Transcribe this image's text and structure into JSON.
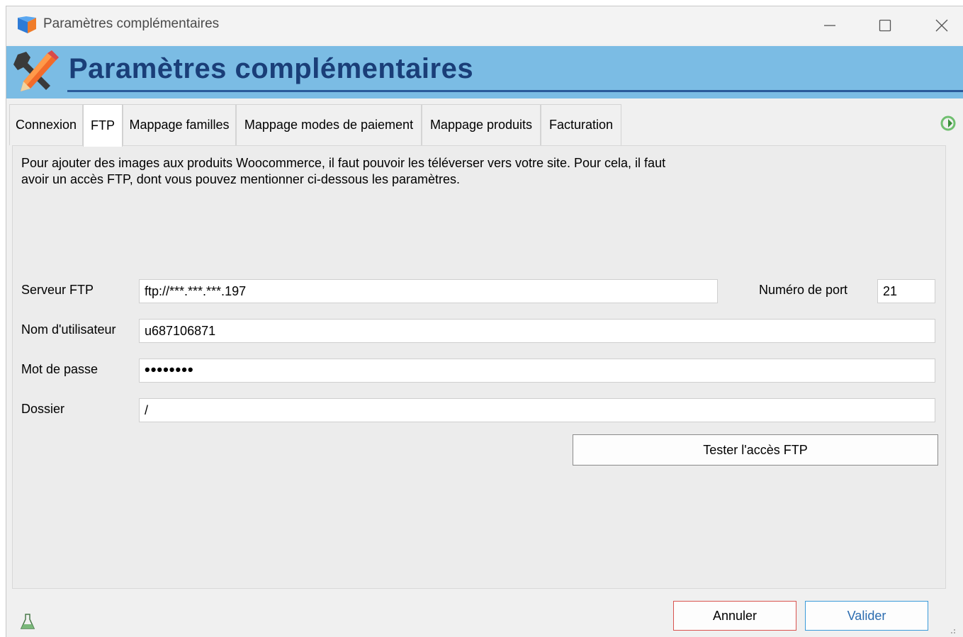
{
  "window": {
    "title": "Paramètres complémentaires",
    "controls": {
      "minimize": "minimize-icon",
      "maximize": "maximize-icon",
      "close": "close-icon"
    }
  },
  "banner": {
    "title": "Paramètres complémentaires",
    "icon": "tools-icon"
  },
  "tabs": [
    {
      "label": "Connexion",
      "active": false
    },
    {
      "label": "FTP",
      "active": true
    },
    {
      "label": "Mappage familles",
      "active": false
    },
    {
      "label": "Mappage modes de paiement",
      "active": false
    },
    {
      "label": "Mappage produits",
      "active": false
    },
    {
      "label": "Facturation",
      "active": false
    }
  ],
  "ftp": {
    "description_line1": "Pour ajouter des images aux produits Woocommerce, il faut pouvoir les téléverser vers votre site. Pour cela, il faut",
    "description_line2": "avoir un accès FTP, dont vous pouvez mentionner ci-dessous les paramètres.",
    "server_label": "Serveur FTP",
    "server_value": "ftp://***.***.***.197",
    "port_label": "Numéro de port",
    "port_value": "21",
    "user_label": "Nom d'utilisateur",
    "user_value": "u687106871",
    "password_label": "Mot de passe",
    "password_value": "••••••••",
    "folder_label": "Dossier",
    "folder_value": "/",
    "test_button": "Tester l'accès FTP"
  },
  "footer": {
    "cancel_label": "Annuler",
    "ok_label": "Valider"
  },
  "colors": {
    "banner_bg": "#7bbce4",
    "banner_title": "#1a3e78",
    "cancel_border": "#d9534f",
    "ok_border": "#3a9ad9"
  }
}
